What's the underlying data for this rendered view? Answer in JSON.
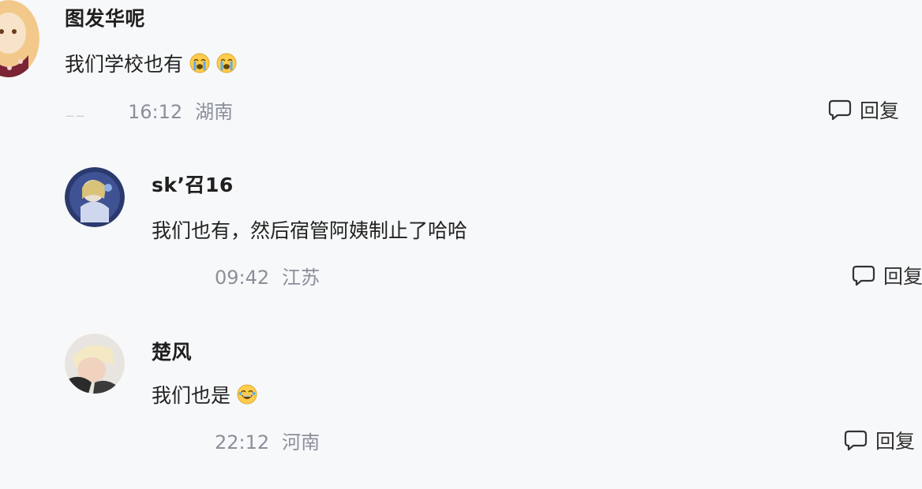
{
  "comments": [
    {
      "username": "图发华呢",
      "text": "我们学校也有",
      "emojis": [
        "crying-emoji",
        "crying-emoji"
      ],
      "time": "16:12",
      "location": "湖南",
      "reply_label": "回复"
    },
    {
      "username": "skʼ召16",
      "text": "我们也有，然后宿管阿姨制止了哈哈",
      "emojis": [],
      "time": "09:42",
      "location": "江苏",
      "reply_label": "回复"
    },
    {
      "username": "楚风  ",
      "text": "我们也是",
      "emojis": [
        "laughing-emoji"
      ],
      "time": "22:12",
      "location": "河南",
      "reply_label": "回复"
    }
  ],
  "colors": {
    "background": "#f7f8fa",
    "meta_text": "#8a8f99",
    "primary_text": "#222222"
  }
}
